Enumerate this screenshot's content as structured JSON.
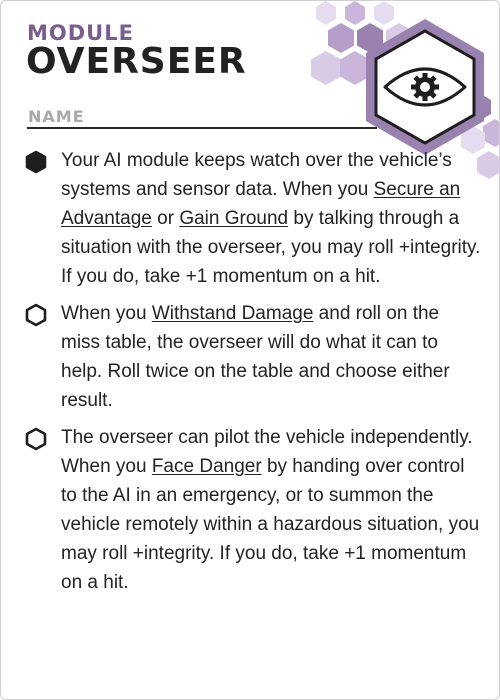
{
  "card": {
    "category": "MODULE",
    "title": "OVERSEER",
    "name_label": "NAME",
    "icon": "eye-gear-icon",
    "accent_color": "#9a82b0",
    "ink_color": "#232323"
  },
  "abilities": [
    {
      "marked": true,
      "marker": "filled-hexagon",
      "parts": [
        "Your AI module keeps watch over the vehicle’s systems and sensor data. When you ",
        "Secure an Advantage",
        " or ",
        "Gain Ground",
        " by talking through a situation with the overseer, you may roll +integrity. If you do, take +1 momentum on a hit."
      ]
    },
    {
      "marked": false,
      "marker": "empty-hexagon",
      "parts": [
        "When you ",
        "Withstand Damage",
        " and roll on the miss table, the overseer will do what it can to help. Roll twice on the table and choose either result."
      ]
    },
    {
      "marked": false,
      "marker": "empty-hexagon",
      "parts": [
        "The overseer can pilot the vehicle independently. When you ",
        "Face Danger",
        " by handing over control to the AI in an emergency, or to summon the vehicle remotely within a hazardous situation, you may roll +integrity. If you do, take +1 momentum on a hit."
      ]
    }
  ]
}
